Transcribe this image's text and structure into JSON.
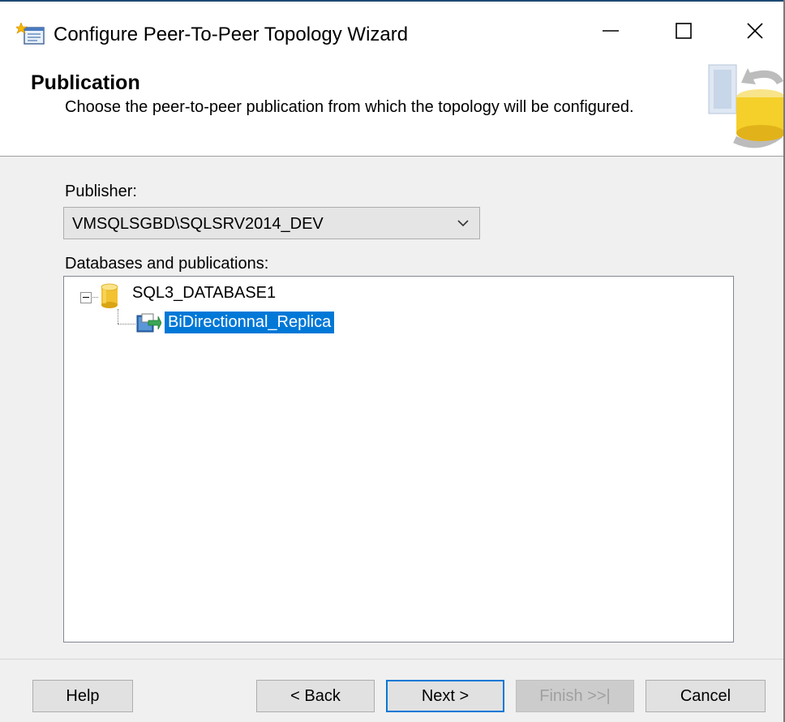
{
  "window": {
    "title": "Configure Peer-To-Peer Topology Wizard",
    "controls": {
      "minimize": "—",
      "maximize": "☐",
      "close": "✕"
    }
  },
  "header": {
    "title": "Publication",
    "subtitle": "Choose the peer-to-peer publication from which the topology will be configured."
  },
  "publisher": {
    "label": "Publisher:",
    "selected": "VMSQLSGBD\\SQLSRV2014_DEV"
  },
  "databases": {
    "label": "Databases and publications:",
    "tree": [
      {
        "name": "SQL3_DATABASE1",
        "icon": "database-icon",
        "expanded": true,
        "children": [
          {
            "name": "BiDirectionnal_Replica",
            "icon": "publication-icon",
            "selected": true
          }
        ]
      }
    ]
  },
  "buttons": {
    "help": "Help",
    "back": "< Back",
    "next": "Next >",
    "finish": "Finish >>|",
    "cancel": "Cancel"
  },
  "colors": {
    "selection": "#0078d7",
    "database": "#f2c230",
    "window_bg": "#f0f0f0"
  }
}
